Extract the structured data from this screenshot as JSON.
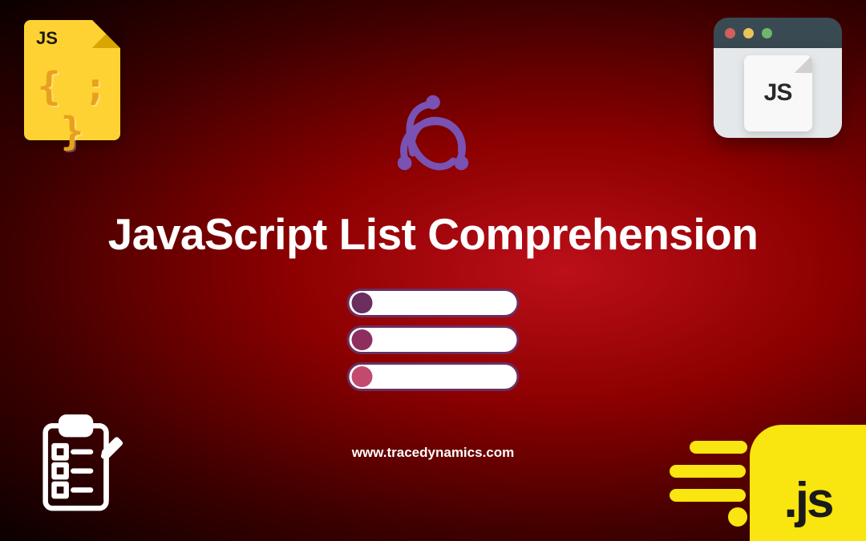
{
  "title": "JavaScript List Comprehension",
  "website_url": "www.tracedynamics.com",
  "js_file": {
    "label": "JS",
    "code": "{ ; }"
  },
  "browser_paper": {
    "text": "JS"
  },
  "js_speed_box": {
    "text": ".js"
  }
}
